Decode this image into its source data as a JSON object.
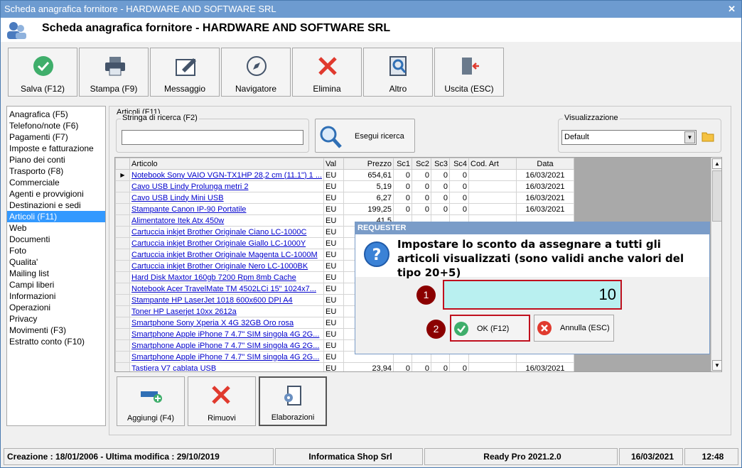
{
  "window": {
    "title": "Scheda anagrafica fornitore - HARDWARE AND SOFTWARE SRL",
    "close_glyph": "✕"
  },
  "header": {
    "title": "Scheda anagrafica fornitore - HARDWARE AND SOFTWARE SRL",
    "icon": "user-card-icon"
  },
  "toolbar": {
    "save_label": "Salva (F12)",
    "print_label": "Stampa (F9)",
    "message_label": "Messaggio",
    "navigator_label": "Navigatore",
    "delete_label": "Elimina",
    "other_label": "Altro",
    "exit_label": "Uscita (ESC)"
  },
  "sidebar": {
    "items": [
      {
        "label": "Anagrafica (F5)"
      },
      {
        "label": "Telefono/note (F6)"
      },
      {
        "label": "Pagamenti (F7)"
      },
      {
        "label": "Imposte e fatturazione"
      },
      {
        "label": "Piano dei conti"
      },
      {
        "label": "Trasporto (F8)"
      },
      {
        "label": "Commerciale"
      },
      {
        "label": "Agenti e provvigioni"
      },
      {
        "label": "Destinazioni e sedi"
      },
      {
        "label": "Articoli (F11)"
      },
      {
        "label": "Web"
      },
      {
        "label": "Documenti"
      },
      {
        "label": "Foto"
      },
      {
        "label": "Qualita'"
      },
      {
        "label": "Mailing list"
      },
      {
        "label": "Campi liberi"
      },
      {
        "label": "Informazioni"
      },
      {
        "label": "Operazioni"
      },
      {
        "label": "Privacy"
      },
      {
        "label": "Movimenti (F3)"
      },
      {
        "label": "Estratto conto (F10)"
      }
    ],
    "selected": "Articoli (F11)"
  },
  "articles": {
    "group_label": "Articoli (F11)",
    "search_label": "Stringa di ricerca (F2)",
    "search_value": "",
    "search_button": "Esegui ricerca",
    "view_label": "Visualizzazione",
    "view_value": "Default",
    "columns": [
      "Articolo",
      "Val",
      "Prezzo",
      "Sc1",
      "Sc2",
      "Sc3",
      "Sc4",
      "Cod. Art",
      "Data"
    ],
    "rows": [
      [
        "Notebook Sony VAIO VGN-TX1HP 28,2 cm (11.1\") 1 ...",
        "EU",
        "654,61",
        "0",
        "0",
        "0",
        "0",
        "",
        "16/03/2021"
      ],
      [
        "Cavo USB Lindy Prolunga metri 2",
        "EU",
        "5,19",
        "0",
        "0",
        "0",
        "0",
        "",
        "16/03/2021"
      ],
      [
        "Cavo USB Lindy Mini USB",
        "EU",
        "6,27",
        "0",
        "0",
        "0",
        "0",
        "",
        "16/03/2021"
      ],
      [
        "Stampante Canon IP-90 Portatile",
        "EU",
        "199,25",
        "0",
        "0",
        "0",
        "0",
        "",
        "16/03/2021"
      ],
      [
        "Alimentatore Itek Atx 450w",
        "EU",
        "41,5",
        "",
        "",
        "",
        "",
        "",
        ""
      ],
      [
        "Cartuccia inkjet Brother Originale Ciano LC-1000C",
        "EU",
        "",
        "",
        "",
        "",
        "",
        "",
        ""
      ],
      [
        "Cartuccia inkjet Brother Originale Giallo LC-1000Y",
        "EU",
        "",
        "",
        "",
        "",
        "",
        "",
        ""
      ],
      [
        "Cartuccia inkjet Brother Originale Magenta LC-1000M",
        "EU",
        "",
        "",
        "",
        "",
        "",
        "",
        ""
      ],
      [
        "Cartuccia inkjet Brother Originale Nero LC-1000BK",
        "EU",
        "",
        "",
        "",
        "",
        "",
        "",
        ""
      ],
      [
        "Hard Disk Maxtor 160gb 7200 Rpm 8mb Cache",
        "EU",
        "",
        "",
        "",
        "",
        "",
        "",
        ""
      ],
      [
        "Notebook Acer TravelMate TM 4502LCi 15\" 1024x7...",
        "EU",
        "",
        "",
        "",
        "",
        "",
        "",
        ""
      ],
      [
        "Stampante HP LaserJet 1018 600x600 DPI A4",
        "EU",
        "",
        "",
        "",
        "",
        "",
        "",
        ""
      ],
      [
        "Toner HP Laserjet 10xx 2612a",
        "EU",
        "",
        "",
        "",
        "",
        "",
        "",
        ""
      ],
      [
        "Smartphone Sony Xperia X 4G 32GB Oro rosa",
        "EU",
        "",
        "",
        "",
        "",
        "",
        "",
        ""
      ],
      [
        "Smartphone Apple iPhone 7 4.7\" SIM singola 4G 2G...",
        "EU",
        "",
        "",
        "",
        "",
        "",
        "",
        ""
      ],
      [
        "Smartphone Apple iPhone 7 4.7\" SIM singola 4G 2G...",
        "EU",
        "",
        "",
        "",
        "",
        "",
        "",
        ""
      ],
      [
        "Smartphone Apple iPhone 7 4.7\" SIM singola 4G 2G...",
        "EU",
        "",
        "",
        "",
        "",
        "",
        "",
        ""
      ],
      [
        "Tastiera V7 cablata USB",
        "EU",
        "23,94",
        "0",
        "0",
        "0",
        "0",
        "",
        "16/03/2021"
      ]
    ],
    "add_label": "Aggiungi (F4)",
    "remove_label": "Rimuovi",
    "process_label": "Elaborazioni"
  },
  "dialog": {
    "title": "REQUESTER",
    "message": "Impostare lo sconto da assegnare a tutti gli articoli visualizzati (sono validi anche valori del tipo 20+5)",
    "input_value": "10",
    "ok_label": "OK (F12)",
    "cancel_label": "Annulla (ESC)",
    "badge1": "1",
    "badge2": "2"
  },
  "status": {
    "dates": "Creazione : 18/01/2006 - Ultima modifica : 29/10/2019",
    "company": "Informatica Shop Srl",
    "version": "Ready Pro 2021.2.0",
    "date": "16/03/2021",
    "time": "12:48"
  },
  "colors": {
    "accent": "#6d9bd0",
    "selection": "#3399ff",
    "highlight": "#c0101e",
    "input_bg": "#b9f0f0"
  }
}
